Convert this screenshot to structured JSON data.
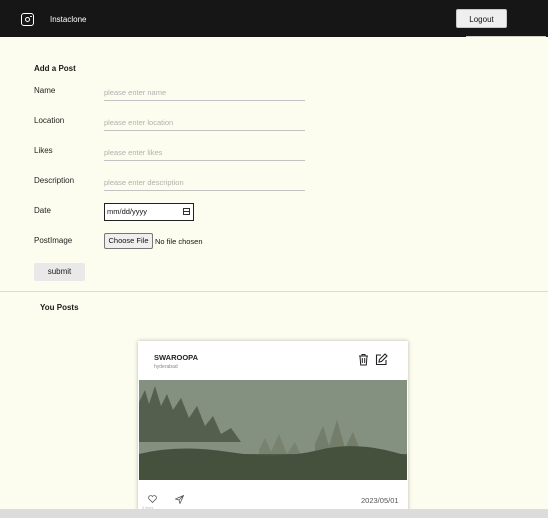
{
  "navbar": {
    "brand": "Instaclone",
    "logout_label": "Logout"
  },
  "form": {
    "title": "Add a Post",
    "fields": [
      {
        "label": "Name",
        "placeholder": "please enter name"
      },
      {
        "label": "Location",
        "placeholder": "please enter location"
      },
      {
        "label": "Likes",
        "placeholder": "please enter likes"
      },
      {
        "label": "Description",
        "placeholder": "please enter description"
      }
    ],
    "date": {
      "label": "Date",
      "placeholder": "mm/dd/yyyy"
    },
    "image": {
      "label": "PostImage",
      "button_label": "Choose File",
      "status": "No file chosen"
    },
    "submit_label": "submit"
  },
  "posts_section": {
    "title": "You Posts",
    "posts": [
      {
        "author": "SWAROOPA",
        "location": "hyderabad",
        "likes_text": "0 likes",
        "date": "2023/05/01"
      }
    ]
  },
  "colors": {
    "navbar": "#161616",
    "page_bg": "#fdfdef"
  },
  "icons": {
    "logo": "instagram-icon",
    "delete": "trash-icon",
    "edit": "edit-icon",
    "like": "heart-icon",
    "share": "send-icon",
    "calendar": "calendar-icon"
  }
}
